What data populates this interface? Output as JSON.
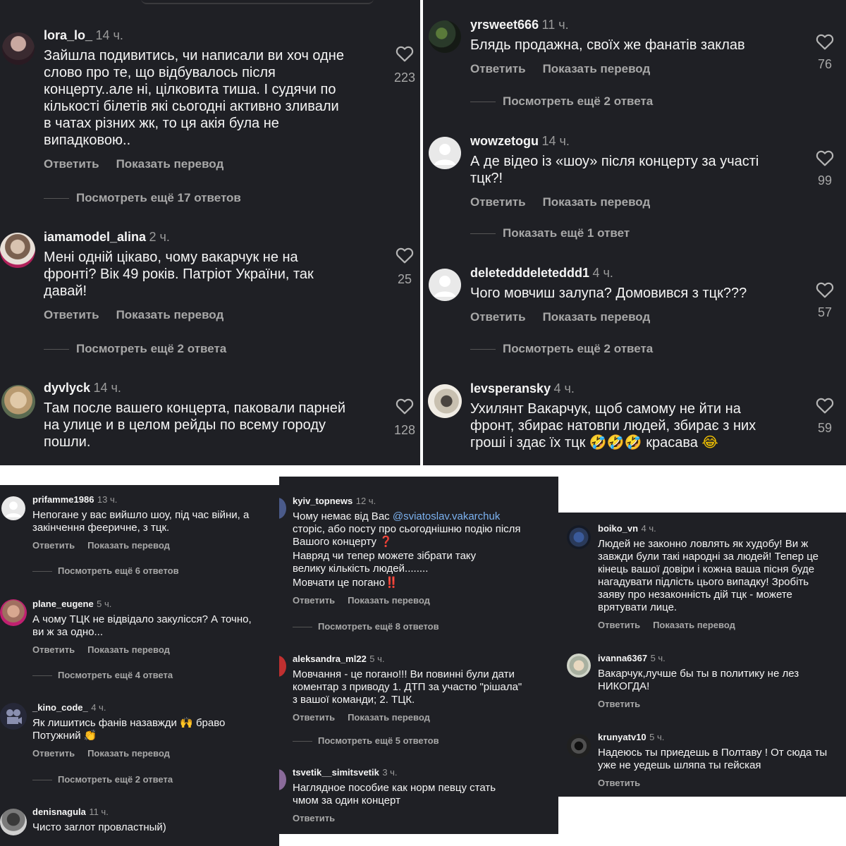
{
  "ui": {
    "reply_label": "Ответить",
    "translate_label": "Показать перевод"
  },
  "panel_a": {
    "comments": [
      {
        "username": "lora_lo_",
        "time": "14 ч.",
        "text": "Зайшла подивитись, чи написали ви хоч одне\nслово про те, що відбувалось після\nконцерту..але ні, цілковита тиша. І судячи по\nкількості білетів які сьогодні активно зливали\nв чатах різних жк, то ця акія була не\nвипадковою..",
        "likes": "223",
        "replies": "Посмотреть ещё 17 ответов"
      },
      {
        "username": "iamamodel_alina",
        "time": "2 ч.",
        "text": "Мені одній цікаво, чому вакарчук не на\nфронті? Вік 49 років. Патріот України, так\nдавай!",
        "likes": "25",
        "replies": "Посмотреть ещё 2 ответа"
      },
      {
        "username": "dyvlyck",
        "time": "14 ч.",
        "text": "Там после вашего концерта, паковали парней\nна улице и в целом рейды по всему городу\nпошли.",
        "likes": "128"
      }
    ]
  },
  "panel_b": {
    "comments": [
      {
        "username": "yrsweet666",
        "time": "11 ч.",
        "text": "Блядь продажна, своїх же фанатів заклав",
        "likes": "76",
        "replies": "Посмотреть ещё 2 ответа"
      },
      {
        "username": "wowzetogu",
        "time": "14 ч.",
        "text": "А де відео із «шоу» після концерту за участі\nтцк?!",
        "likes": "99",
        "replies": "Показать ещё 1 ответ"
      },
      {
        "username": "deletedddeleteddd1",
        "time": "4 ч.",
        "text": "Чого мовчиш залупа? Домовився з тцк???",
        "likes": "57",
        "replies": "Посмотреть ещё 2 ответа"
      },
      {
        "username": "levsperansky",
        "time": "4 ч.",
        "text": "Ухилянт Вакарчук, щоб самому не йти на\nфронт, збирає натовпи людей, збирає з них\nгроші і здає їх тцк",
        "emoji": "🤣🤣🤣",
        "text_tail": "красава",
        "emoji2": "😂",
        "likes": "59"
      }
    ]
  },
  "panel_c": {
    "comments": [
      {
        "username": "prifamme1986",
        "time": "13 ч.",
        "text": "Непогане у вас вийшло шоу, під час війни, а\nзакінчення фееричне, з тцк.",
        "replies": "Посмотреть ещё 6 ответов"
      },
      {
        "username": "plane_eugene",
        "time": "5 ч.",
        "text": "А чому ТЦК не відвідало закулісся? А точно,\nви ж за одно...",
        "replies": "Посмотреть ещё 4 ответа"
      },
      {
        "username": "_kino_code_",
        "time": "4 ч.",
        "text": "Як лишитись фанів назавжди",
        "emoji": "🙌",
        "text_tail": "браво",
        "text2": "Потужний",
        "emoji2": "👏",
        "replies": "Посмотреть ещё 2 ответа"
      },
      {
        "username": "denisnagula",
        "time": "11 ч.",
        "text": "Чисто заглот провластный)"
      }
    ]
  },
  "panel_d": {
    "comments": [
      {
        "username": "kyiv_topnews",
        "time": "12 ч.",
        "text_start": "Чому немає від Вас",
        "mention": "@sviatoslav.vakarchuk",
        "text_mid": "сторіс, або посту про сьогоднішню подію після\nВашого концерту",
        "mark1": "❓",
        "text_p2": "Навряд чи тепер можете зібрати таку\nвелику кількість людей........",
        "text_p3": "Мовчати це погано",
        "mark2": "‼️",
        "replies": "Посмотреть ещё 8 ответов"
      },
      {
        "username": "aleksandra_ml22",
        "time": "5 ч.",
        "text": "Мовчання - це погано!!! Ви повинні були дати\nкоментар з приводу 1. ДТП за участю \"рішала\"\nз вашої команди; 2. ТЦК.",
        "replies": "Посмотреть ещё 5 ответов"
      },
      {
        "username": "tsvetik__simitsvetik",
        "time": "3 ч.",
        "text": "Наглядное пособие как норм певцу стать\nчмом за один концерт"
      }
    ]
  },
  "panel_e": {
    "comments": [
      {
        "username": "boiko_vn",
        "time": "4 ч.",
        "text": "Людей не законно ловлять як худобу! Ви ж\nзавжди були такі народні за людей! Тепер це\nкінець вашої довіри і кожна ваша пісня буде\nнагадувати підлість цього випадку! Зробіть\nзаяву про незаконність дій тцк - можете\nврятувати лице."
      },
      {
        "username": "ivanna6367",
        "time": "5 ч.",
        "text": "Вакарчук,лучше бы ты в политику не лез\nНИКОГДА!"
      },
      {
        "username": "krunyatv10",
        "time": "5 ч.",
        "text": "Надеюсь ты приедешь в Полтаву ! От сюда ты\nуже не уедешь шляпа ты гейская"
      }
    ]
  },
  "colors": {
    "panel_bg": "#1f2025",
    "text": "#f5f5f5",
    "muted": "#a8a8a8",
    "mention": "#7cb2f0"
  }
}
